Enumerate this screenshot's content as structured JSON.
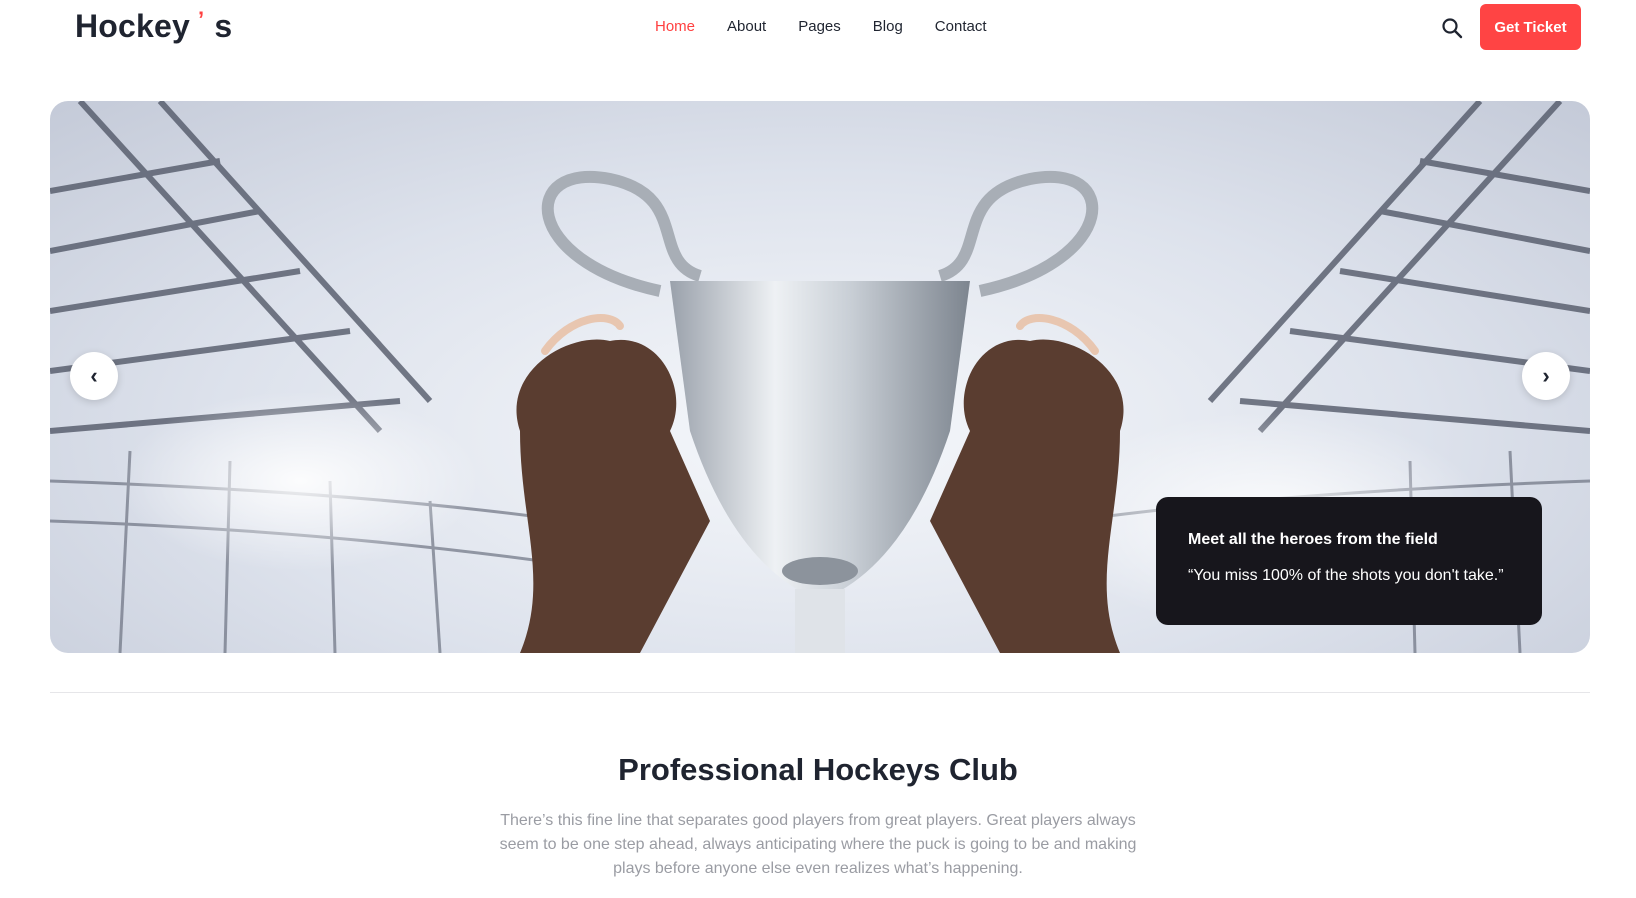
{
  "brand": {
    "name_main": "Hockey",
    "name_apostrophe": "’",
    "name_suffix": "s",
    "accent_color": "#ff4444"
  },
  "nav": {
    "items": [
      {
        "label": "Home",
        "active": true
      },
      {
        "label": "About",
        "active": false
      },
      {
        "label": "Pages",
        "active": false
      },
      {
        "label": "Blog",
        "active": false
      },
      {
        "label": "Contact",
        "active": false
      }
    ]
  },
  "header_actions": {
    "search_icon": "search-icon",
    "ticket_label": "Get Ticket"
  },
  "hero": {
    "prev_glyph": "‹",
    "next_glyph": "›",
    "caption_title": "Meet all the heroes from the field",
    "caption_quote": "“You miss 100% of the shots you don't take.”"
  },
  "intro": {
    "title": "Professional Hockeys Club",
    "text": "There’s this fine line that separates good players from great players. Great players always seem to be one step ahead, always anticipating where the puck is going to be and making plays before anyone else even realizes what’s happening."
  }
}
